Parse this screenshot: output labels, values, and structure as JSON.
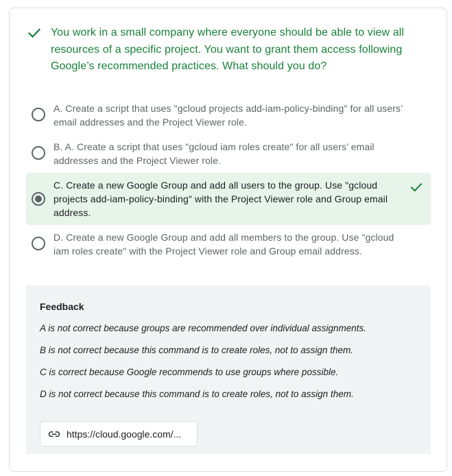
{
  "colors": {
    "correct": "#188038",
    "selected_bg": "#e6f4ea",
    "feedback_bg": "#f1f3f4",
    "border": "#dadce0"
  },
  "question": {
    "status_icon": "check-icon",
    "text": "You work in a small company where everyone should be able to view all resources of a specific project. You want to grant them access following Google’s recommended practices. What should you do?"
  },
  "options": [
    {
      "text": "A. Create a script that uses \"gcloud projects add-iam-policy-binding\" for all users’ email addresses and the Project Viewer role.",
      "selected": false,
      "correct": false
    },
    {
      "text": "B. A. Create a script that uses \"gcloud iam roles create\" for all users’ email addresses and the Project Viewer role.",
      "selected": false,
      "correct": false
    },
    {
      "text": "C. Create a new Google Group and add all users to the group. Use \"gcloud projects add-iam-policy-binding\" with the Project Viewer role and Group email address.",
      "selected": true,
      "correct": true
    },
    {
      "text": "D. Create a new Google Group and add all members to the group. Use \"gcloud iam roles create\" with the Project Viewer role and Group email address.",
      "selected": false,
      "correct": false
    }
  ],
  "feedback": {
    "title": "Feedback",
    "lines": [
      "A is not correct because groups are recommended over individual assignments.",
      "B is not correct because this command is to create roles, not to assign them.",
      "C is correct because Google recommends to use groups where possible.",
      "D is not correct because this command is to create roles, not to assign them."
    ],
    "link": {
      "icon": "link-icon",
      "text": "https://cloud.google.com/..."
    }
  }
}
